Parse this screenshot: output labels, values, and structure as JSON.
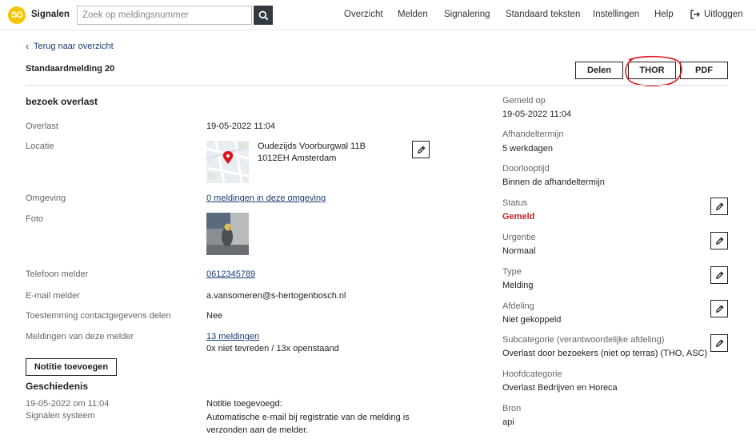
{
  "header": {
    "logo_text": "SG",
    "brand": "Signalen",
    "search_placeholder": "Zoek op meldingsnummer",
    "nav": [
      "Overzicht",
      "Melden",
      "Signalering",
      "Standaard teksten",
      "Instellingen",
      "Help",
      "Uitloggen"
    ]
  },
  "back_link": "Terug naar overzicht",
  "page_title": "Standaardmelding 20",
  "actions": {
    "share": "Delen",
    "thor": "THOR",
    "pdf": "PDF"
  },
  "main": {
    "heading": "bezoek overlast",
    "overlast_label": "Overlast",
    "overlast_value": "19-05-2022 11:04",
    "locatie_label": "Locatie",
    "locatie_line1": "Oudezijds Voorburgwal 11B",
    "locatie_line2": "1012EH Amsterdam",
    "omgeving_label": "Omgeving",
    "omgeving_value": "0 meldingen in deze omgeving",
    "foto_label": "Foto",
    "telefoon_label": "Telefoon melder",
    "telefoon_value": "0612345789",
    "email_label": "E-mail melder",
    "email_value": "a.vansomeren@s-hertogenbosch.nl",
    "toestemming_label": "Toestemming contactgegevens delen",
    "toestemming_value": "Nee",
    "meldingen_label": "Meldingen van deze melder",
    "meldingen_value": "13 meldingen",
    "meldingen_sub": "0x niet tevreden / 13x openstaand",
    "note_button": "Notitie toevoegen",
    "history_heading": "Geschiedenis",
    "history": {
      "date": "19-05-2022 om 11:04",
      "source": "Signalen systeem",
      "line1": "Notitie toegevoegd:",
      "line2": "Automatische e-mail bij registratie van de melding is",
      "line3": "verzonden aan de melder."
    }
  },
  "side": {
    "gemeld_op_label": "Gemeld op",
    "gemeld_op_value": "19-05-2022 11:04",
    "afhandeltermijn_label": "Afhandeltermijn",
    "afhandeltermijn_value": "5 werkdagen",
    "doorlooptijd_label": "Doorlooptijd",
    "doorlooptijd_value": "Binnen de afhandeltermijn",
    "status_label": "Status",
    "status_value": "Gemeld",
    "urgentie_label": "Urgentie",
    "urgentie_value": "Normaal",
    "type_label": "Type",
    "type_value": "Melding",
    "afdeling_label": "Afdeling",
    "afdeling_value": "Niet gekoppeld",
    "subcategorie_label": "Subcategorie (verantwoordelijke afdeling)",
    "subcategorie_value": "Overlast door bezoekers (niet op terras) (THO, ASC)",
    "hoofdcategorie_label": "Hoofdcategorie",
    "hoofdcategorie_value": "Overlast Bedrijven en Horeca",
    "bron_label": "Bron",
    "bron_value": "api"
  },
  "colors": {
    "logo": "#f5c400",
    "link": "#1a3b73",
    "status": "#c0262d",
    "annotation": "#e0141e"
  }
}
